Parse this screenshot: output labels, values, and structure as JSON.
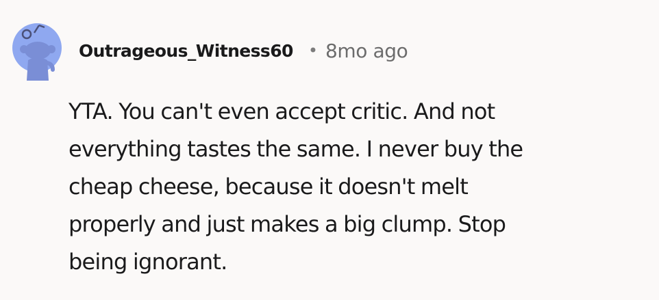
{
  "comment": {
    "author": {
      "username": "Outrageous_Witness60",
      "avatar_icon": "reddit-snoo-avatar-icon",
      "avatar_color": "#8fa8f0"
    },
    "separator": "•",
    "timestamp": "8mo ago",
    "body_lines": [
      "YTA. You can't even accept critic. And not",
      "everything tastes the same. I never buy the",
      "cheap cheese, because it doesn't melt",
      "properly and just makes a big clump. Stop",
      "being ignorant."
    ]
  }
}
